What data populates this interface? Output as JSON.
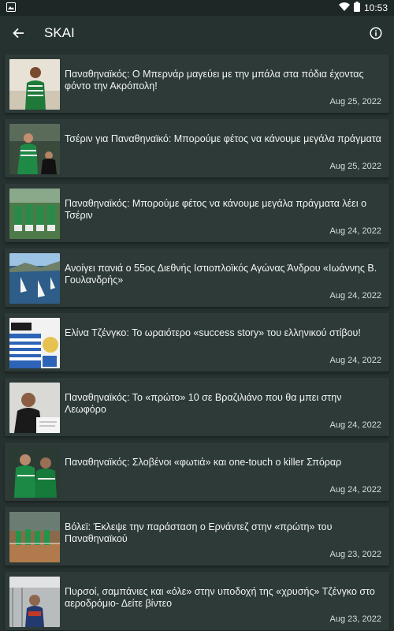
{
  "status_bar": {
    "time": "10:53"
  },
  "app_bar": {
    "title": "SKAI"
  },
  "articles": [
    {
      "title": "Παναθηναϊκός: Ο Μπερνάρ μαγεύει με την μπάλα στα πόδια έχοντας φόντο την Ακρόπολη!",
      "date": "Aug 25, 2022"
    },
    {
      "title": "Τσέριν για Παναθηναϊκό: Μπορούμε φέτος να κάνουμε μεγάλα πράγματα",
      "date": "Aug 25, 2022"
    },
    {
      "title": "Παναθηναϊκός: Μπορούμε φέτος να κάνουμε μεγάλα πράγματα λέει ο Τσέριν",
      "date": "Aug 24, 2022"
    },
    {
      "title": "Ανοίγει πανιά ο 55ος Διεθνής Ιστιοπλοϊκός Αγώνας Άνδρου «Ιωάννης Β. Γουλανδρής»",
      "date": "Aug 24, 2022"
    },
    {
      "title": "Ελίνα Τζένγκο: Το ωραιότερο «success story» του ελληνικού στίβου!",
      "date": "Aug 24, 2022"
    },
    {
      "title": "Παναθηναϊκός: Το «πρώτο» 10 σε Βραζιλιάνο που θα μπει στην Λεωφόρο",
      "date": "Aug 24, 2022"
    },
    {
      "title": "Παναθηναϊκός: Σλοβένοι «φωτιά» και one-touch o killer Σπόραρ",
      "date": "Aug 24, 2022"
    },
    {
      "title": "Βόλεϊ: Έκλεψε την παράσταση ο Ερνάντεζ στην «πρώτη» του Παναθηναϊκού",
      "date": "Aug 23, 2022"
    },
    {
      "title": "Πυρσοί, σαμπάνιες και «όλε» στην υποδοχή της «χρυσής» Τζένγκο στο αεροδρόμιο- Δείτε βίντεο",
      "date": "Aug 23, 2022"
    }
  ]
}
